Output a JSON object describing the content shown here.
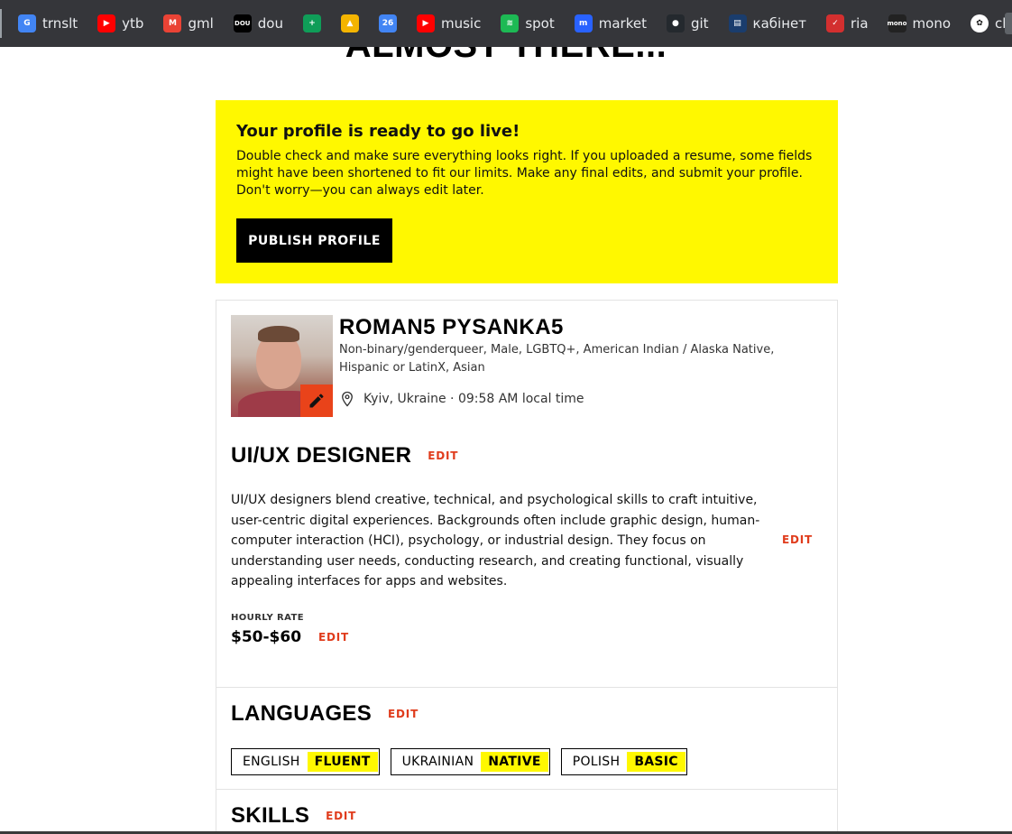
{
  "bookmarks": [
    {
      "label": "trnslt",
      "icon": "google-translate-icon",
      "color": "#4285f4",
      "glyph": "G"
    },
    {
      "label": "ytb",
      "icon": "youtube-icon",
      "color": "#ff0000",
      "glyph": "▶"
    },
    {
      "label": "gml",
      "icon": "gmail-icon",
      "color": "#ea4335",
      "glyph": "M"
    },
    {
      "label": "dou",
      "icon": "dou-icon",
      "color": "#000000",
      "glyph": "DOU"
    },
    {
      "label": "",
      "icon": "sheets-icon",
      "color": "#0f9d58",
      "glyph": "+"
    },
    {
      "label": "",
      "icon": "drive-icon",
      "color": "#f4b400",
      "glyph": "▲"
    },
    {
      "label": "",
      "icon": "calendar-icon",
      "color": "#4285f4",
      "glyph": "26"
    },
    {
      "label": "music",
      "icon": "youtube-music-icon",
      "color": "#ff0000",
      "glyph": "▶"
    },
    {
      "label": "spot",
      "icon": "spotify-icon",
      "color": "#1db954",
      "glyph": "≋"
    },
    {
      "label": "market",
      "icon": "market-icon",
      "color": "#2962ff",
      "glyph": "m"
    },
    {
      "label": "git",
      "icon": "github-icon",
      "color": "#24292e",
      "glyph": "●"
    },
    {
      "label": "кабінет",
      "icon": "cabinet-icon",
      "color": "#1a3d6d",
      "glyph": "▤"
    },
    {
      "label": "ria",
      "icon": "ria-icon",
      "color": "#d32f2f",
      "glyph": "✓"
    },
    {
      "label": "mono",
      "icon": "mono-icon",
      "color": "#222222",
      "glyph": "mono"
    },
    {
      "label": "chatGPT",
      "icon": "chatgpt-icon",
      "color": "#ffffff",
      "glyph": "✿"
    }
  ],
  "page": {
    "heading": "ALMOST THERE..."
  },
  "banner": {
    "title": "Your profile is ready to go live!",
    "text": "Double check and make sure everything looks right. If you uploaded a resume, some fields might have been shortened to fit our limits. Make any final edits, and submit your profile. Don't worry—you can always edit later.",
    "button": "PUBLISH PROFILE",
    "color": "#fff800"
  },
  "profile": {
    "name": "ROMAN5 PYSANKA5",
    "identity": "Non-binary/genderqueer, Male, LGBTQ+, American Indian / Alaska Native, Hispanic or LatinX, Asian",
    "location": "Kyiv, Ukraine · 09:58 AM local time",
    "role": "UI/UX DESIGNER",
    "bio": "UI/UX designers blend creative, technical, and psychological skills to craft intuitive, user-centric digital experiences. Backgrounds often include graphic design, human-computer interaction (HCI), psychology, or industrial design. They focus on understanding user needs, conducting research, and creating functional, visually appealing interfaces for apps and websites.",
    "rate_label": "HOURLY RATE",
    "rate": "$50-$60",
    "edit_label": "EDIT",
    "accent_color": "#e03c1c"
  },
  "languages": {
    "title": "LANGUAGES",
    "items": [
      {
        "name": "ENGLISH",
        "level": "FLUENT"
      },
      {
        "name": "UKRAINIAN",
        "level": "NATIVE"
      },
      {
        "name": "POLISH",
        "level": "BASIC"
      }
    ]
  },
  "skills": {
    "title": "SKILLS"
  }
}
